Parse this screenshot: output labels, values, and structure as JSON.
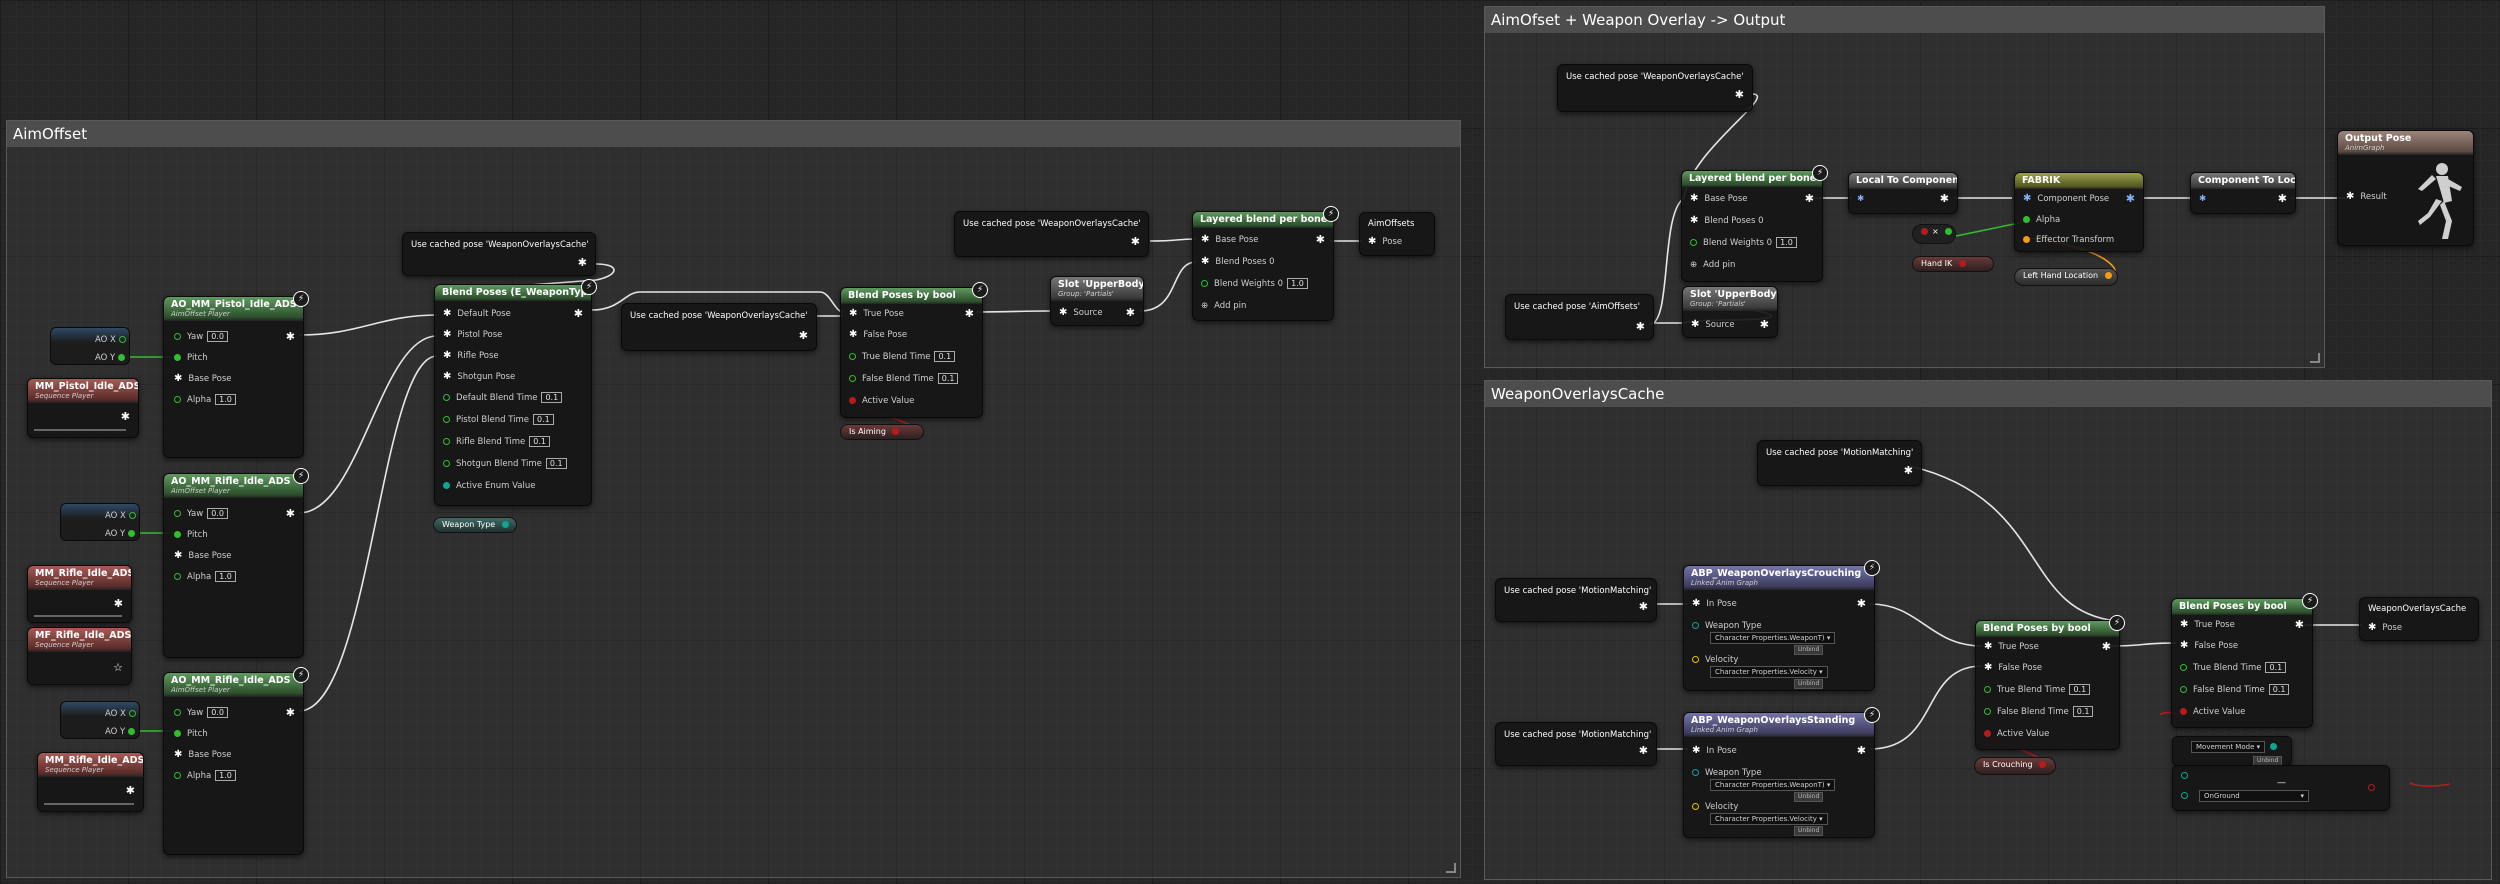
{
  "comments": {
    "aimoffset": "AimOffset",
    "output_group": "AimOfset + Weapon Overlay -> Output",
    "overlays_cache": "WeaponOverlaysCache"
  },
  "pins": {
    "ao_x": "AO X",
    "ao_y": "AO Y",
    "yaw": "Yaw",
    "pitch": "Pitch",
    "base_pose": "Base Pose",
    "alpha": "Alpha",
    "alpha_value": "1.0",
    "yaw_value": "0.0",
    "source": "Source",
    "pose": "Pose",
    "in_pose": "In Pose",
    "true_pose": "True Pose",
    "false_pose": "False Pose",
    "true_blend_time": "True Blend Time",
    "false_blend_time": "False Blend Time",
    "blend_time_value": "0.1",
    "active_value": "Active Value",
    "blend_poses_0": "Blend Poses 0",
    "blend_weights_0": "Blend Weights 0",
    "add_pin": "Add pin",
    "component_pose": "Component Pose",
    "effector_transform": "Effector Transform",
    "result": "Result",
    "weapon_type": "Weapon Type",
    "velocity": "Velocity",
    "weapon_type_value": "Character Properties.WeaponT)",
    "velocity_value": "Character Properties.Velocity",
    "default_pose": "Default Pose",
    "pistol_pose": "Pistol Pose",
    "rifle_pose": "Rifle Pose",
    "shotgun_pose": "Shotgun Pose",
    "default_blend_time": "Default Blend Time",
    "pistol_blend_time": "Pistol Blend Time",
    "rifle_blend_time": "Rifle Blend Time",
    "shotgun_blend_time": "Shotgun Blend Time",
    "active_enum_value": "Active Enum Value",
    "unbind": "Unbind"
  },
  "aimoffset_nodes": {
    "ao_pistol": {
      "title": "AO_MM_Pistol_Idle_ADS",
      "subtitle": "AimOffset Player"
    },
    "ao_rifle_1": {
      "title": "AO_MM_Rifle_Idle_ADS",
      "subtitle": "AimOffset Player"
    },
    "ao_rifle_2": {
      "title": "AO_MM_Rifle_Idle_ADS",
      "subtitle": "AimOffset Player"
    },
    "seq_pistol": {
      "title": "MM_Pistol_Idle_ADS",
      "subtitle": "Sequence Player"
    },
    "seq_rifle_1": {
      "title": "MM_Rifle_Idle_ADS",
      "subtitle": "Sequence Player"
    },
    "mf_rifle": {
      "title": "MF_Rifle_Idle_ADS",
      "subtitle": "Sequence Player"
    },
    "seq_rifle_2": {
      "title": "MM_Rifle_Idle_ADS",
      "subtitle": "Sequence Player"
    },
    "cached_a": "Use cached pose 'WeaponOverlaysCache'",
    "cached_b": "Use cached pose 'WeaponOverlaysCache'",
    "cached_c": "Use cached pose 'WeaponOverlaysCache'",
    "blend_enum": "Blend Poses (E_WeaponType)",
    "weapon_type_pill": "Weapon Type",
    "blend_bool": "Blend Poses by bool",
    "is_aiming": "Is Aiming",
    "slot": {
      "title": "Slot 'UpperBody'",
      "subtitle": "Group: 'Partials'"
    },
    "layered": "Layered blend per bone",
    "result": "AimOffsets"
  },
  "output_nodes": {
    "cached_weapon": "Use cached pose 'WeaponOverlaysCache'",
    "cached_aim": "Use cached pose 'AimOffsets'",
    "layered": "Layered blend per bone",
    "slot": {
      "title": "Slot 'UpperBody'",
      "subtitle": "Group: 'Partials'"
    },
    "local_to_component": "Local To Component",
    "fabrik": "FABRIK",
    "component_to_local": "Component To Local",
    "output_pose": {
      "title": "Output Pose",
      "subtitle": "AnimGraph"
    },
    "multiply": "×",
    "hand_ik": "Hand IK",
    "left_hand_location": "Left Hand Location"
  },
  "cache_nodes": {
    "cached_mm_1": "Use cached pose 'MotionMatching'",
    "cached_mm_2": "Use cached pose 'MotionMatching'",
    "cached_mm_3": "Use cached pose 'MotionMatching'",
    "crouching": {
      "title": "ABP_WeaponOverlaysCrouching",
      "subtitle": "Linked Anim Graph"
    },
    "standing": {
      "title": "ABP_WeaponOverlaysStanding",
      "subtitle": "Linked Anim Graph"
    },
    "blend_1": "Blend Poses by bool",
    "blend_2": "Blend Poses by bool",
    "is_crouching": "Is Crouching",
    "movement_mode": "Movement Mode",
    "on_ground": "OnGround",
    "result": "WeaponOverlaysCache"
  }
}
